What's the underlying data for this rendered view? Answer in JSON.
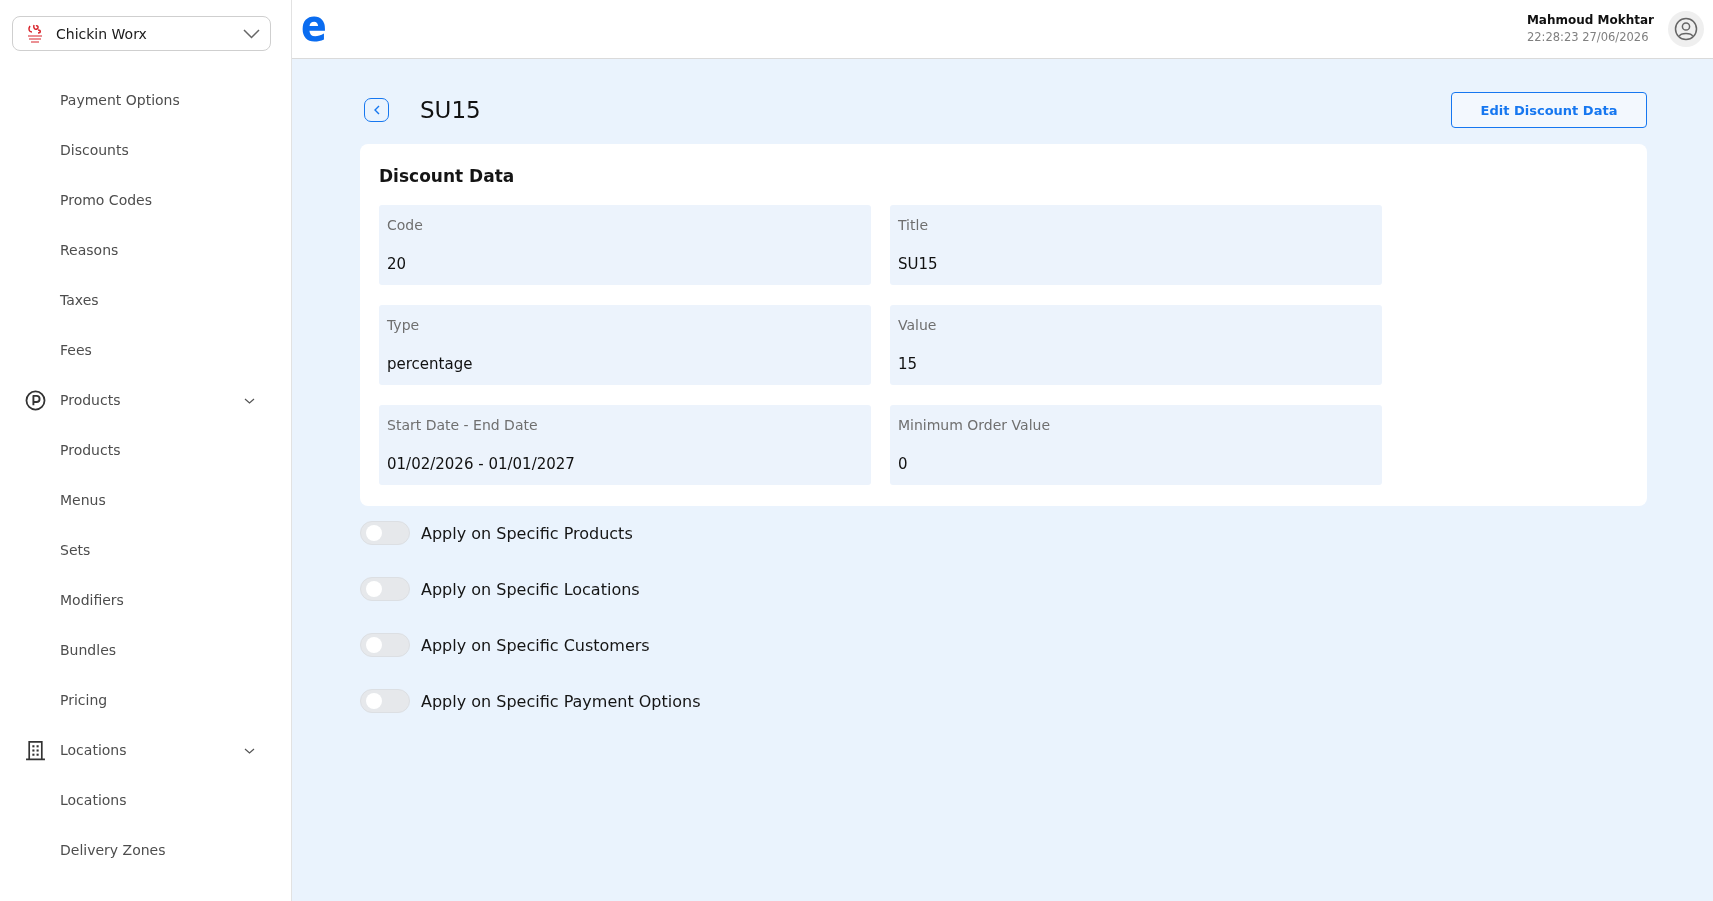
{
  "sidebar": {
    "store_selector": {
      "value": "Chickin Worx"
    },
    "items": [
      {
        "kind": "link",
        "label": "Payment Options"
      },
      {
        "kind": "link",
        "label": "Discounts"
      },
      {
        "kind": "link",
        "label": "Promo Codes"
      },
      {
        "kind": "link",
        "label": "Reasons"
      },
      {
        "kind": "link",
        "label": "Taxes"
      },
      {
        "kind": "link",
        "label": "Fees"
      },
      {
        "kind": "group",
        "label": "Products",
        "expanded": true,
        "children": [
          {
            "label": "Products"
          },
          {
            "label": "Menus"
          },
          {
            "label": "Sets"
          },
          {
            "label": "Modifiers"
          },
          {
            "label": "Bundles"
          },
          {
            "label": "Pricing"
          }
        ]
      },
      {
        "kind": "group",
        "label": "Locations",
        "expanded": true,
        "children": [
          {
            "label": "Locations"
          },
          {
            "label": "Delivery Zones"
          }
        ]
      }
    ]
  },
  "header": {
    "logo": "e",
    "user": {
      "name": "Mahmoud Mokhtar",
      "timestamp": "22:28:23 27/06/2026"
    }
  },
  "page": {
    "title": "SU15",
    "edit_button": "Edit Discount Data",
    "discount_data": {
      "heading": "Discount Data",
      "fields": [
        {
          "label": "Code",
          "value": "20"
        },
        {
          "label": "Title",
          "value": "SU15"
        },
        {
          "label": "Type",
          "value": "percentage"
        },
        {
          "label": "Value",
          "value": "15"
        },
        {
          "label": "Start Date - End Date",
          "value": "01/02/2026 - 01/01/2027"
        },
        {
          "label": "Minimum Order Value",
          "value": "0"
        }
      ]
    },
    "options": [
      {
        "label": "Apply on Specific Products",
        "on": false
      },
      {
        "label": "Apply on Specific Locations",
        "on": false
      },
      {
        "label": "Apply on Specific Customers",
        "on": false
      },
      {
        "label": "Apply on Specific Payment Options",
        "on": false
      }
    ]
  }
}
